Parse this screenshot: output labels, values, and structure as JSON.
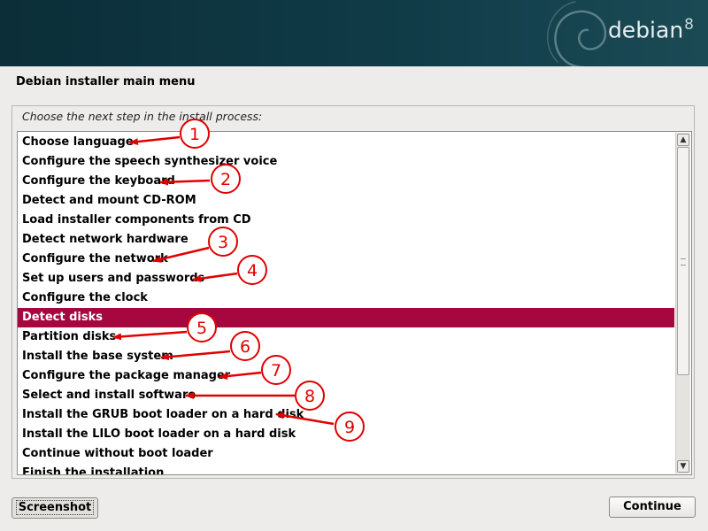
{
  "header": {
    "brand": "debian",
    "version": "8"
  },
  "title": "Debian installer main menu",
  "prompt": "Choose the next step in the install process:",
  "menu": {
    "selected_index": 9,
    "items": [
      "Choose language",
      "Configure the speech synthesizer voice",
      "Configure the keyboard",
      "Detect and mount CD-ROM",
      "Load installer components from CD",
      "Detect network hardware",
      "Configure the network",
      "Set up users and passwords",
      "Configure the clock",
      "Detect disks",
      "Partition disks",
      "Install the base system",
      "Configure the package manager",
      "Select and install software",
      "Install the GRUB boot loader on a hard disk",
      "Install the LILO boot loader on a hard disk",
      "Continue without boot loader",
      "Finish the installation"
    ]
  },
  "buttons": {
    "screenshot": "Screenshot",
    "continue": "Continue"
  },
  "annotations": [
    "1",
    "2",
    "3",
    "4",
    "5",
    "6",
    "7",
    "8",
    "9"
  ],
  "colors": {
    "banner": "#0f3b47",
    "selection": "#a5073e",
    "annotation": "#e00000"
  }
}
